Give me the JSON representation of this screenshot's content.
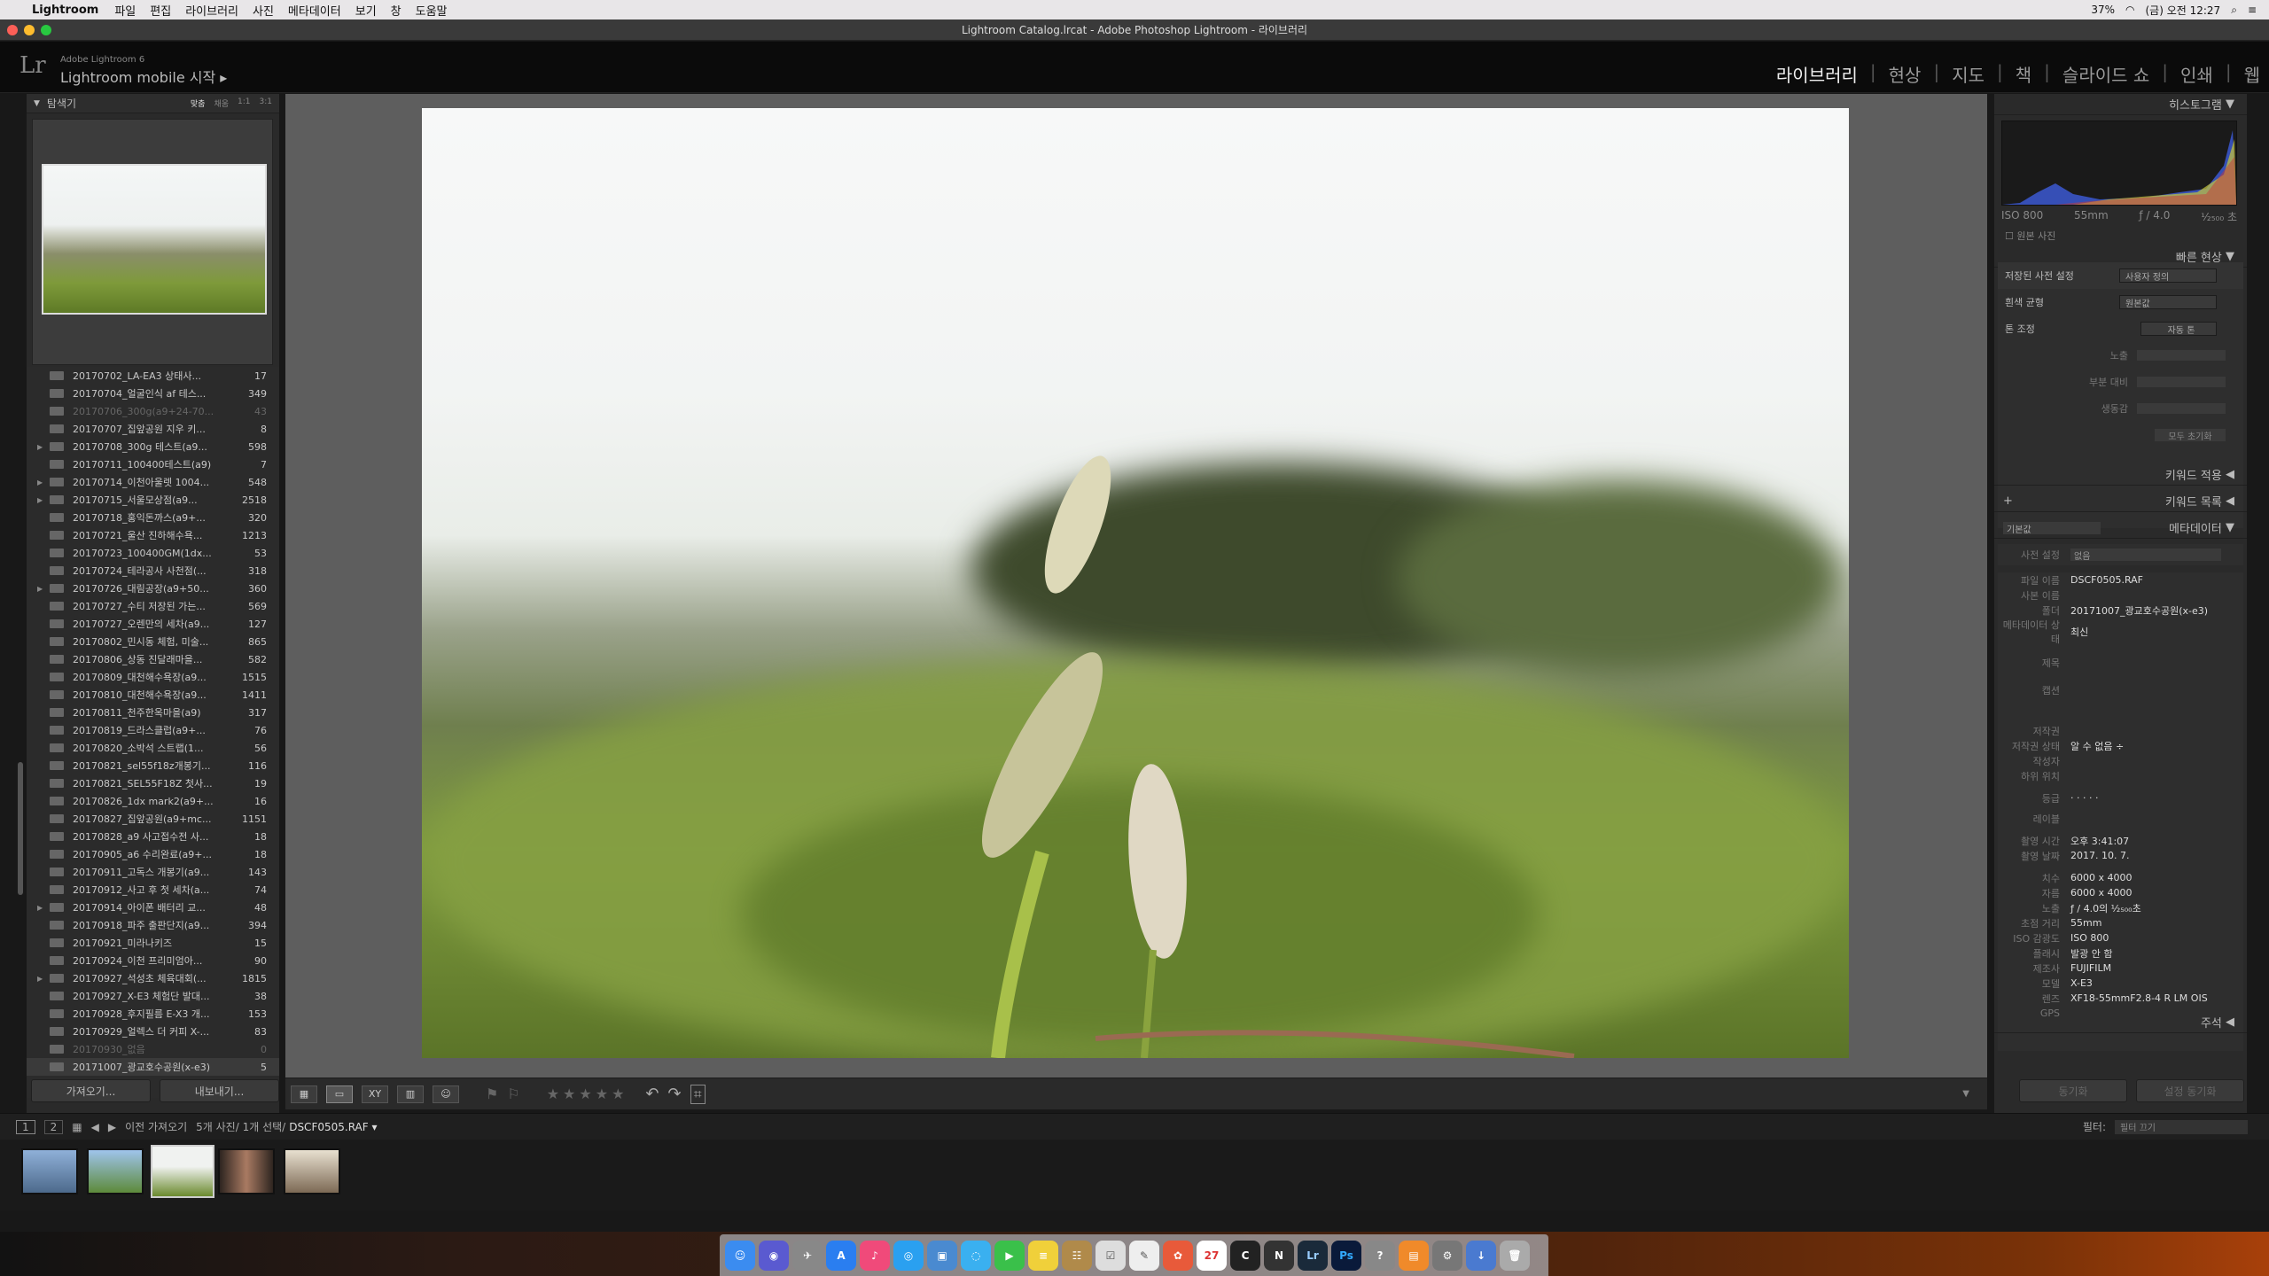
{
  "menubar": {
    "app": "Lightroom",
    "items": [
      "파일",
      "편집",
      "라이브러리",
      "사진",
      "메타데이터",
      "보기",
      "창",
      "도움말"
    ],
    "battery": "37%",
    "clock": "(금) 오전 12:27"
  },
  "window": {
    "title": "Lightroom Catalog.lrcat - Adobe Photoshop Lightroom - 라이브러리"
  },
  "header": {
    "brand": "Adobe Lightroom 6",
    "mobile": "Lightroom mobile 시작",
    "modules": [
      "라이브러리",
      "현상",
      "지도",
      "책",
      "슬라이드 쇼",
      "인쇄",
      "웹"
    ]
  },
  "navigator": {
    "title": "탐색기",
    "zoom": [
      "맞춤",
      "채움",
      "1:1",
      "3:1"
    ]
  },
  "folders": [
    {
      "name": "20170702_LA-EA3 상태사...",
      "count": "17"
    },
    {
      "name": "20170704_얼굴인식 af 테스...",
      "count": "349"
    },
    {
      "name": "20170706_300g(a9+24-70...",
      "count": "43",
      "dim": true
    },
    {
      "name": "20170707_집앞공원 지우 키...",
      "count": "8"
    },
    {
      "name": "20170708_300g 테스트(a9...",
      "count": "598",
      "expand": true
    },
    {
      "name": "20170711_100400테스트(a9)",
      "count": "7"
    },
    {
      "name": "20170714_이천아울렛 1004...",
      "count": "548",
      "expand": true
    },
    {
      "name": "20170715_서울모상점(a9...",
      "count": "2518",
      "expand": true
    },
    {
      "name": "20170718_홍익돈까스(a9+...",
      "count": "320"
    },
    {
      "name": "20170721_울산 진하해수욕...",
      "count": "1213"
    },
    {
      "name": "20170723_100400GM(1dx...",
      "count": "53"
    },
    {
      "name": "20170724_테라공사 사천점(...",
      "count": "318"
    },
    {
      "name": "20170726_대림공장(a9+50...",
      "count": "360",
      "expand": true
    },
    {
      "name": "20170727_수티 저장된 가는...",
      "count": "569"
    },
    {
      "name": "20170727_오렌만의 세차(a9...",
      "count": "127"
    },
    {
      "name": "20170802_민시동 체험, 미술...",
      "count": "865"
    },
    {
      "name": "20170806_상동 진달래마을...",
      "count": "582"
    },
    {
      "name": "20170809_대천해수욕장(a9...",
      "count": "1515"
    },
    {
      "name": "20170810_대천해수욕장(a9...",
      "count": "1411"
    },
    {
      "name": "20170811_천주한옥마을(a9)",
      "count": "317"
    },
    {
      "name": "20170819_드라스클럽(a9+...",
      "count": "76"
    },
    {
      "name": "20170820_소박석 스트랩(1...",
      "count": "56"
    },
    {
      "name": "20170821_sel55f18z개봉기...",
      "count": "116"
    },
    {
      "name": "20170821_SEL55F18Z 첫사...",
      "count": "19"
    },
    {
      "name": "20170826_1dx mark2(a9+...",
      "count": "16"
    },
    {
      "name": "20170827_집앞공원(a9+mc...",
      "count": "1151"
    },
    {
      "name": "20170828_a9 사고접수전 사...",
      "count": "18"
    },
    {
      "name": "20170905_a6 수리완료(a9+...",
      "count": "18"
    },
    {
      "name": "20170911_고독스 개봉기(a9...",
      "count": "143"
    },
    {
      "name": "20170912_사고 후 첫 세차(a...",
      "count": "74"
    },
    {
      "name": "20170914_아이폰 배터리 교...",
      "count": "48",
      "expand": true
    },
    {
      "name": "20170918_파주 출판단지(a9...",
      "count": "394"
    },
    {
      "name": "20170921_미라나키즈",
      "count": "15"
    },
    {
      "name": "20170924_이천 프리미엄아...",
      "count": "90"
    },
    {
      "name": "20170927_석성초 체육대회(...",
      "count": "1815",
      "expand": true
    },
    {
      "name": "20170927_X-E3 체험단 발대...",
      "count": "38"
    },
    {
      "name": "20170928_후지필름 E-X3 개...",
      "count": "153"
    },
    {
      "name": "20170929_얼렉스 더 커피 X-...",
      "count": "83"
    },
    {
      "name": "20170930_없음",
      "count": "0",
      "dim": true
    },
    {
      "name": "20171007_광교호수공원(x-e3)",
      "count": "5"
    }
  ],
  "left_buttons": {
    "import": "가져오기...",
    "export": "내보내기..."
  },
  "histogram": {
    "title": "히스토그램",
    "iso": "ISO 800",
    "focal": "55mm",
    "aperture": "ƒ / 4.0",
    "shutter": "¹⁄₂₅₀₀ 초",
    "original": "원본 사진"
  },
  "quick_develop": {
    "title": "빠른 현상",
    "preset_label": "저장된 사전 설정",
    "preset_value": "사용자 정의",
    "wb_label": "흰색 균형",
    "wb_value": "원본값",
    "tone_label": "톤 조정",
    "tone_value": "자동 톤",
    "exposure": "노출",
    "clarity": "부분 대비",
    "vibrance": "생동감",
    "reset": "모두 초기화"
  },
  "keywording": "키워드 적용",
  "keyword_list": "키워드 목록",
  "metadata_panel": {
    "title": "메타데이터",
    "preset_select": "기본값",
    "preset_label": "사전 설정",
    "preset_value": "없음",
    "rows": [
      {
        "k": "파일 이름",
        "v": "DSCF0505.RAF"
      },
      {
        "k": "사본 이름",
        "v": ""
      },
      {
        "k": "폴더",
        "v": "20171007_광교호수공원(x-e3)"
      },
      {
        "k": "메타데이터 상태",
        "v": "최신"
      },
      {
        "k": "제목",
        "v": ""
      },
      {
        "k": "캡션",
        "v": ""
      },
      {
        "k": "저작권",
        "v": ""
      },
      {
        "k": "저작권 상태",
        "v": "알 수 없음 ÷"
      },
      {
        "k": "작성자",
        "v": ""
      },
      {
        "k": "하위 위치",
        "v": ""
      },
      {
        "k": "등급",
        "v": "· · · · ·"
      },
      {
        "k": "레이블",
        "v": ""
      },
      {
        "k": "촬영 시간",
        "v": "오후 3:41:07"
      },
      {
        "k": "촬영 날짜",
        "v": "2017. 10. 7."
      },
      {
        "k": "치수",
        "v": "6000 x 4000"
      },
      {
        "k": "자름",
        "v": "6000 x 4000"
      },
      {
        "k": "노출",
        "v": "ƒ / 4.0의 ¹⁄₂₅₀₀초"
      },
      {
        "k": "초점 거리",
        "v": "55mm"
      },
      {
        "k": "ISO 감광도",
        "v": "ISO 800"
      },
      {
        "k": "플래시",
        "v": "발광 안 함"
      },
      {
        "k": "제조사",
        "v": "FUJIFILM"
      },
      {
        "k": "모델",
        "v": "X-E3"
      },
      {
        "k": "렌즈",
        "v": "XF18-55mmF2.8-4 R LM OIS"
      },
      {
        "k": "GPS",
        "v": ""
      }
    ]
  },
  "comments": "주석",
  "right_buttons": {
    "sync": "동기화",
    "sync_settings": "설정 동기화"
  },
  "filmbar": {
    "page1": "1",
    "page2": "2",
    "prev_import": "이전 가져오기",
    "selection": "5개 사진/ 1개 선택/",
    "filename": "DSCF0505.RAF ▾",
    "filter_label": "필터:",
    "filter_value": "필터 끄기"
  },
  "colors": {
    "accent": "#e6e6e6",
    "panel": "#2a2a2a",
    "center": "#5e5e5e"
  }
}
